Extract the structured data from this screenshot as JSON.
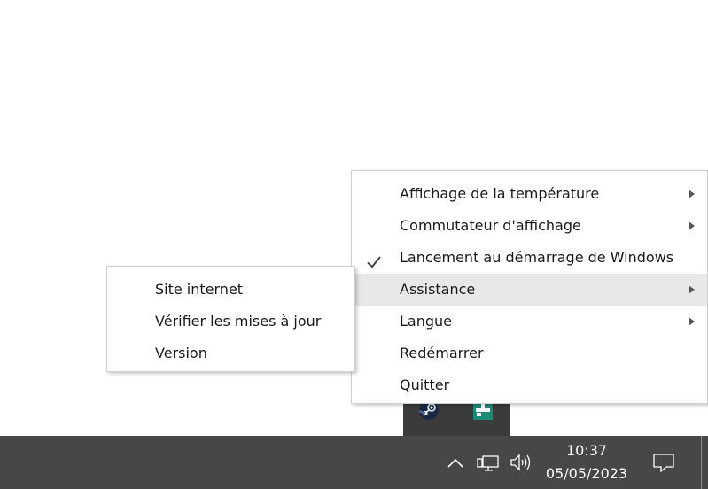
{
  "main_menu": {
    "items": [
      {
        "label": "Affichage de la température",
        "has_submenu": true,
        "checked": false,
        "highlighted": false
      },
      {
        "label": "Commutateur d'affichage",
        "has_submenu": true,
        "checked": false,
        "highlighted": false
      },
      {
        "label": "Lancement au démarrage de Windows",
        "has_submenu": false,
        "checked": true,
        "highlighted": false
      },
      {
        "label": "Assistance",
        "has_submenu": true,
        "checked": false,
        "highlighted": true
      },
      {
        "label": "Langue",
        "has_submenu": true,
        "checked": false,
        "highlighted": false
      },
      {
        "label": "Redémarrer",
        "has_submenu": false,
        "checked": false,
        "highlighted": false
      },
      {
        "label": "Quitter",
        "has_submenu": false,
        "checked": false,
        "highlighted": false
      }
    ]
  },
  "sub_menu": {
    "items": [
      {
        "label": "Site internet"
      },
      {
        "label": "Vérifier les mises à jour"
      },
      {
        "label": "Version"
      }
    ]
  },
  "tray_overflow": {
    "icons": [
      "steam-icon",
      "app-icon"
    ]
  },
  "taskbar": {
    "time": "10:37",
    "date": "05/05/2023",
    "icons": [
      "chevron-up-icon",
      "network-icon",
      "volume-icon",
      "notification-icon"
    ]
  },
  "colors": {
    "taskbar_bg": "#474747",
    "menu_bg": "#ffffff",
    "highlight_bg": "#e8e8e8",
    "tray_overflow_bg": "#3b3b3b",
    "app_icon_green": "#1d8a78"
  }
}
